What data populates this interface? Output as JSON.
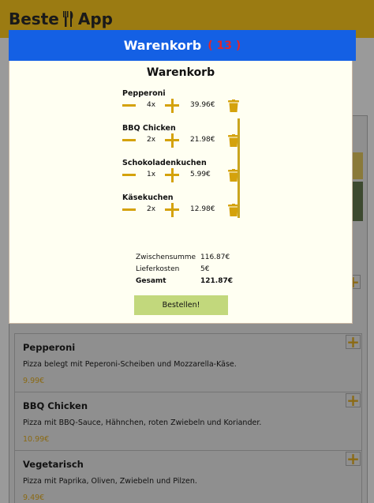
{
  "header": {
    "brand_left": "Beste",
    "brand_right": "App",
    "brand_icon": "fork-knife-icon"
  },
  "menu": {
    "items": [
      {
        "name": "Pepperoni",
        "description": "Pizza belegt mit Peperoni-Scheiben und Mozzarella-Käse.",
        "price": "9.99€"
      },
      {
        "name": "BBQ Chicken",
        "description": "Pizza mit BBQ-Sauce, Hähnchen, roten Zwiebeln und Koriander.",
        "price": "10.99€"
      },
      {
        "name": "Vegetarisch",
        "description": "Pizza mit Paprika, Oliven, Zwiebeln und Pilzen.",
        "price": "9.49€"
      }
    ]
  },
  "cart_bar": {
    "title": "Warenkorb",
    "count": "( 13 )"
  },
  "cart": {
    "title": "Warenkorb",
    "items": [
      {
        "name": "Pepperoni",
        "qty": "4x",
        "price": "39.96€"
      },
      {
        "name": "BBQ Chicken",
        "qty": "2x",
        "price": "21.98€"
      },
      {
        "name": "Schokoladenkuchen",
        "qty": "1x",
        "price": "5.99€"
      },
      {
        "name": "Käsekuchen",
        "qty": "2x",
        "price": "12.98€"
      }
    ],
    "subtotal_label": "Zwischensumme",
    "subtotal_value": "116.87€",
    "delivery_label": "Lieferkosten",
    "delivery_value": "5€",
    "total_label": "Gesamt",
    "total_value": "121.87€",
    "order_button": "Bestellen!"
  },
  "colors": {
    "accent": "#d4a20c",
    "header_bg": "#9b7b12",
    "cart_bar_bg": "#1460e4",
    "count_red": "#e0262c",
    "order_button_bg": "#c2d87c"
  }
}
